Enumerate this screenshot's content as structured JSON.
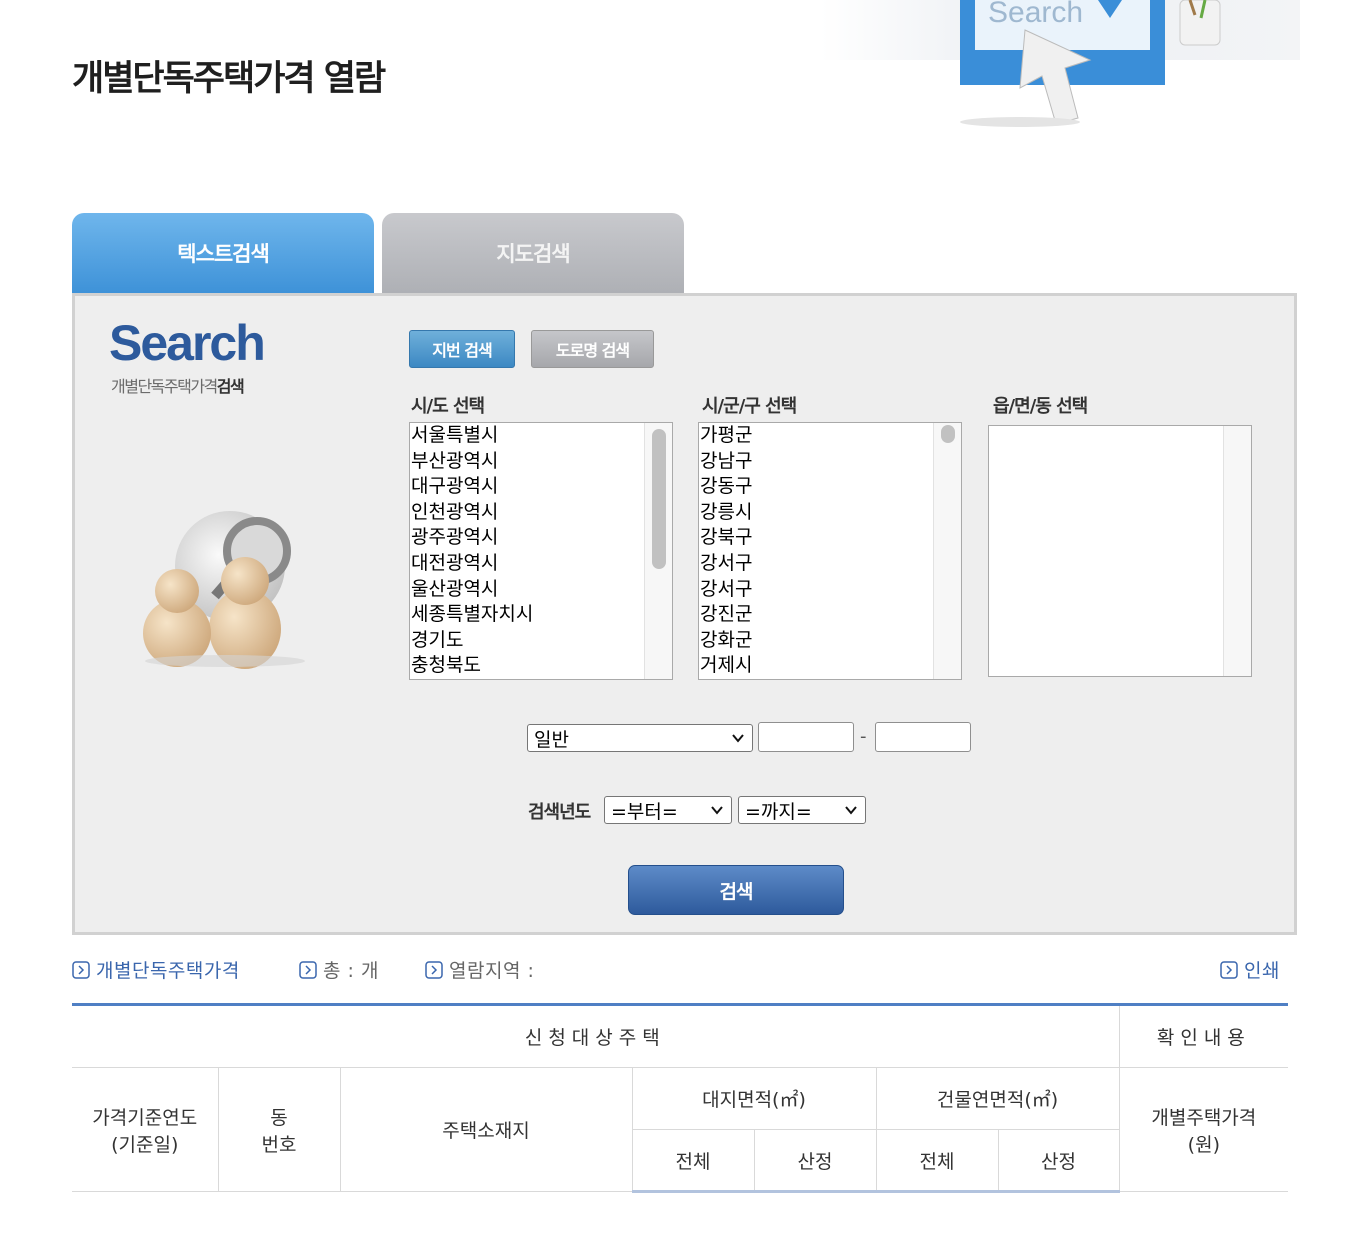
{
  "page": {
    "title": "개별단독주택가격 열람"
  },
  "header_art": {
    "text": "Search"
  },
  "tabs": {
    "text_search": "텍스트검색",
    "map_search": "지도검색"
  },
  "search_panel": {
    "logo_title": "Search",
    "logo_subtitle_normal": "개별단독주택가격",
    "logo_subtitle_bold": "검색",
    "mode_jibun": "지번 검색",
    "mode_road": "도로명 검색",
    "sido_label": "시/도 선택",
    "sigungu_label": "시/군/구 선택",
    "emd_label": "읍/면/동 선택",
    "sido_options": [
      "서울특별시",
      "부산광역시",
      "대구광역시",
      "인천광역시",
      "광주광역시",
      "대전광역시",
      "울산광역시",
      "세종특별자치시",
      "경기도",
      "충청북도"
    ],
    "sigungu_options": [
      "가평군",
      "강남구",
      "강동구",
      "강릉시",
      "강북구",
      "강서구",
      "강서구",
      "강진군",
      "강화군",
      "거제시"
    ],
    "lot_type_selected": "일반",
    "lot_separator": "-",
    "year_label": "검색년도",
    "year_from_selected": "=부터=",
    "year_to_selected": "=까지=",
    "search_button": "검색"
  },
  "info_bar": {
    "category": "개별단독주택가격",
    "total": "총 : 개",
    "region": "열람지역 :",
    "print": "인쇄"
  },
  "table": {
    "group_applicant": "신청대상주택",
    "group_confirm": "확인내용",
    "col_year": "가격기준연도",
    "col_year_sub": "(기준일)",
    "col_dong": "동",
    "col_dong_sub": "번호",
    "col_address": "주택소재지",
    "col_land_area": "대지면적(㎡)",
    "col_building_area": "건물연면적(㎡)",
    "col_price": "개별주택가격",
    "col_price_sub": "(원)",
    "sub_total": "전체",
    "sub_calc": "산정"
  },
  "colors": {
    "accent_blue": "#3e92d8",
    "nav_blue": "#2e5a9c",
    "link_blue": "#3a66ad"
  }
}
